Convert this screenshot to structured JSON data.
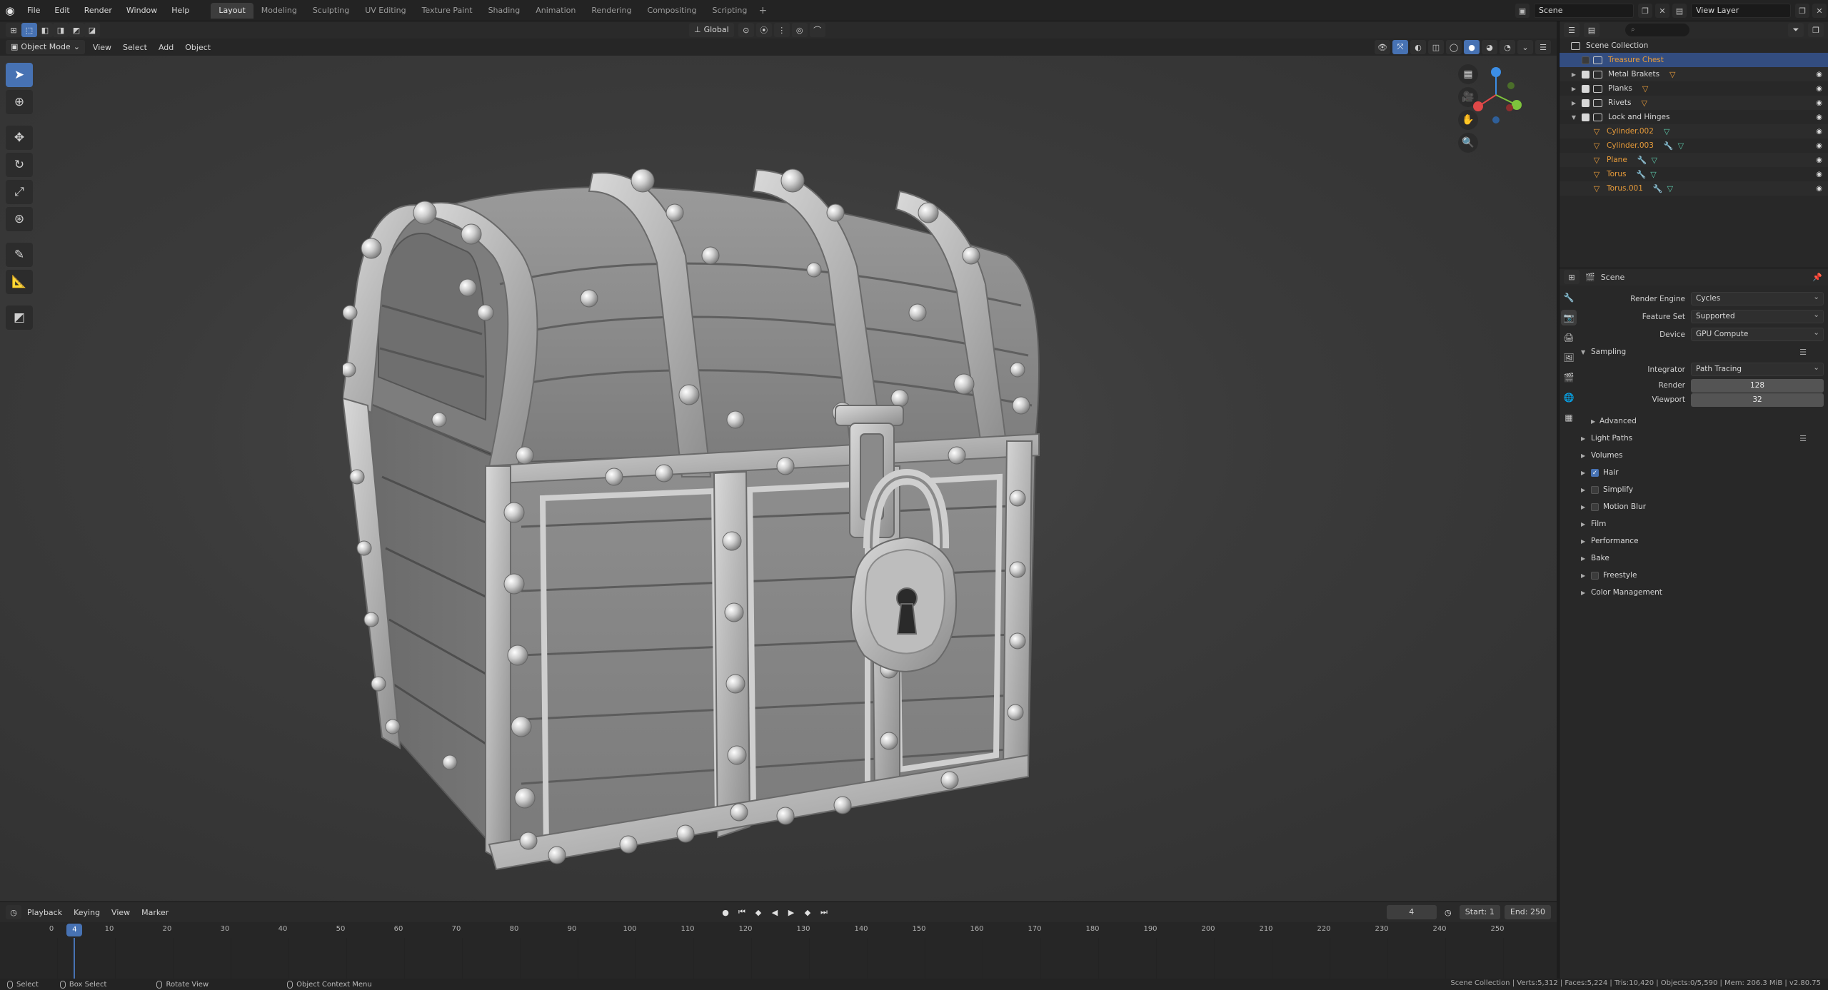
{
  "topbar": {
    "menus": [
      "File",
      "Edit",
      "Render",
      "Window",
      "Help"
    ],
    "workspaces": [
      "Layout",
      "Modeling",
      "Sculpting",
      "UV Editing",
      "Texture Paint",
      "Shading",
      "Animation",
      "Rendering",
      "Compositing",
      "Scripting"
    ],
    "active_workspace": "Layout",
    "scene_name": "Scene",
    "view_layer": "View Layer"
  },
  "viewport_header": {
    "mode": "Object Mode",
    "menus": [
      "View",
      "Select",
      "Add",
      "Object"
    ],
    "transform_orientation": "Global"
  },
  "timeline": {
    "menus": [
      "Playback",
      "Keying",
      "View",
      "Marker"
    ],
    "current_frame": "4",
    "start_label": "Start:",
    "start": "1",
    "end_label": "End:",
    "end": "250",
    "ticks": [
      "0",
      "10",
      "20",
      "30",
      "40",
      "50",
      "60",
      "70",
      "80",
      "90",
      "100",
      "110",
      "120",
      "130",
      "140",
      "150",
      "160",
      "170",
      "180",
      "190",
      "200",
      "210",
      "220",
      "230",
      "240",
      "250"
    ]
  },
  "statusbar": {
    "select": "Select",
    "box_select": "Box Select",
    "rotate_view": "Rotate View",
    "context_menu": "Object Context Menu",
    "stats": "Scene Collection | Verts:5,312 | Faces:5,224 | Tris:10,420 | Objects:0/5,590 | Mem: 206.3 MiB | v2.80.75"
  },
  "outliner": {
    "root": "Scene Collection",
    "rows": [
      {
        "name": "Treasure Chest",
        "kind": "collection",
        "selected": true
      },
      {
        "name": "Metal Brakets",
        "kind": "collection"
      },
      {
        "name": "Planks",
        "kind": "collection"
      },
      {
        "name": "Rivets",
        "kind": "collection"
      },
      {
        "name": "Lock and Hinges",
        "kind": "collection"
      },
      {
        "name": "Cylinder.002",
        "kind": "mesh"
      },
      {
        "name": "Cylinder.003",
        "kind": "mesh"
      },
      {
        "name": "Plane",
        "kind": "mesh"
      },
      {
        "name": "Torus",
        "kind": "mesh"
      },
      {
        "name": "Torus.001",
        "kind": "mesh"
      }
    ]
  },
  "properties": {
    "context": "Scene",
    "render_engine_label": "Render Engine",
    "render_engine": "Cycles",
    "feature_set_label": "Feature Set",
    "feature_set": "Supported",
    "device_label": "Device",
    "device": "GPU Compute",
    "sampling": "Sampling",
    "integrator_label": "Integrator",
    "integrator": "Path Tracing",
    "render_label": "Render",
    "render_samples": "128",
    "viewport_label": "Viewport",
    "viewport_samples": "32",
    "advanced": "Advanced",
    "panels": [
      {
        "label": "Light Paths",
        "checkbox": null
      },
      {
        "label": "Volumes",
        "checkbox": null
      },
      {
        "label": "Hair",
        "checkbox": true
      },
      {
        "label": "Simplify",
        "checkbox": false
      },
      {
        "label": "Motion Blur",
        "checkbox": false
      },
      {
        "label": "Film",
        "checkbox": null
      },
      {
        "label": "Performance",
        "checkbox": null
      },
      {
        "label": "Bake",
        "checkbox": null
      },
      {
        "label": "Freestyle",
        "checkbox": false
      },
      {
        "label": "Color Management",
        "checkbox": null
      }
    ]
  }
}
